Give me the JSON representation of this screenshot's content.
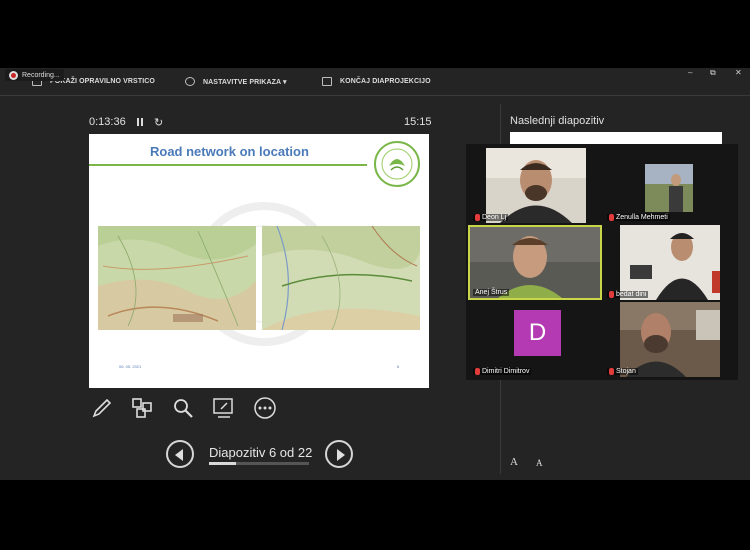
{
  "recording": {
    "label": "Recording..."
  },
  "toolbar": {
    "show_taskbar": "POKAŽI OPRAVILNO VRSTICO",
    "display_settings": "NASTAVITVE PRIKAZA ▾",
    "end_show": "KONČAJ DIAPROJEKCIJO"
  },
  "window": {
    "minimize": "–",
    "restore": "⧉",
    "close": "✕"
  },
  "presenter": {
    "timer": "0:13:36",
    "clock": "15:15"
  },
  "slide": {
    "title": "Road network on location",
    "date": "06. 05. 2021",
    "number": "6"
  },
  "navigation": {
    "counter": "Diapozitiv 6 od 22",
    "progress": 0.27
  },
  "next_slide": {
    "label": "Naslednji diapozitiv"
  },
  "font_controls": {
    "increase": "A",
    "decrease": "A"
  },
  "participants": [
    {
      "name": "Deon Lj",
      "muted": true,
      "active": false
    },
    {
      "name": "Zenulla Mehmeti",
      "muted": true,
      "active": false
    },
    {
      "name": "Anej Štrus",
      "muted": false,
      "active": true
    },
    {
      "name": "bedat dini",
      "muted": true,
      "active": false
    },
    {
      "name": "Dimitri Dimitrov",
      "muted": true,
      "active": false,
      "avatar_letter": "D"
    },
    {
      "name": "Stojan",
      "muted": true,
      "active": false
    }
  ],
  "colors": {
    "slide_title": "#4a7ab8",
    "title_rule": "#7ab648",
    "active_speaker": "#c9d64a",
    "avatar_bg": "#b43ab4",
    "muted_mic": "#e23b3b"
  },
  "icons": [
    "pen-icon",
    "slides-grid-icon",
    "zoom-icon",
    "laser-pointer-icon",
    "more-options-icon"
  ]
}
